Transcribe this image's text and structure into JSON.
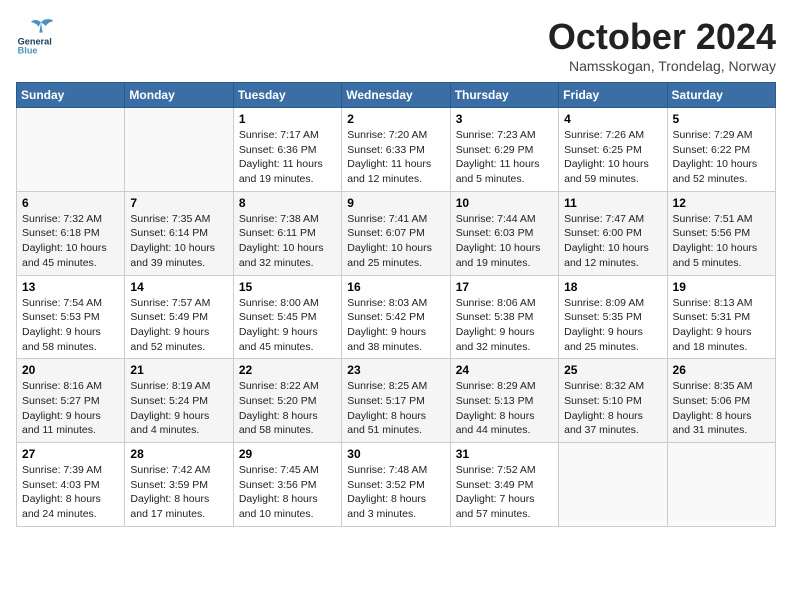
{
  "header": {
    "logo_general": "General",
    "logo_blue": "Blue",
    "month_title": "October 2024",
    "location": "Namsskogan, Trondelag, Norway"
  },
  "days_of_week": [
    "Sunday",
    "Monday",
    "Tuesday",
    "Wednesday",
    "Thursday",
    "Friday",
    "Saturday"
  ],
  "weeks": [
    [
      {
        "day": "",
        "info": ""
      },
      {
        "day": "",
        "info": ""
      },
      {
        "day": "1",
        "info": "Sunrise: 7:17 AM\nSunset: 6:36 PM\nDaylight: 11 hours\nand 19 minutes."
      },
      {
        "day": "2",
        "info": "Sunrise: 7:20 AM\nSunset: 6:33 PM\nDaylight: 11 hours\nand 12 minutes."
      },
      {
        "day": "3",
        "info": "Sunrise: 7:23 AM\nSunset: 6:29 PM\nDaylight: 11 hours\nand 5 minutes."
      },
      {
        "day": "4",
        "info": "Sunrise: 7:26 AM\nSunset: 6:25 PM\nDaylight: 10 hours\nand 59 minutes."
      },
      {
        "day": "5",
        "info": "Sunrise: 7:29 AM\nSunset: 6:22 PM\nDaylight: 10 hours\nand 52 minutes."
      }
    ],
    [
      {
        "day": "6",
        "info": "Sunrise: 7:32 AM\nSunset: 6:18 PM\nDaylight: 10 hours\nand 45 minutes."
      },
      {
        "day": "7",
        "info": "Sunrise: 7:35 AM\nSunset: 6:14 PM\nDaylight: 10 hours\nand 39 minutes."
      },
      {
        "day": "8",
        "info": "Sunrise: 7:38 AM\nSunset: 6:11 PM\nDaylight: 10 hours\nand 32 minutes."
      },
      {
        "day": "9",
        "info": "Sunrise: 7:41 AM\nSunset: 6:07 PM\nDaylight: 10 hours\nand 25 minutes."
      },
      {
        "day": "10",
        "info": "Sunrise: 7:44 AM\nSunset: 6:03 PM\nDaylight: 10 hours\nand 19 minutes."
      },
      {
        "day": "11",
        "info": "Sunrise: 7:47 AM\nSunset: 6:00 PM\nDaylight: 10 hours\nand 12 minutes."
      },
      {
        "day": "12",
        "info": "Sunrise: 7:51 AM\nSunset: 5:56 PM\nDaylight: 10 hours\nand 5 minutes."
      }
    ],
    [
      {
        "day": "13",
        "info": "Sunrise: 7:54 AM\nSunset: 5:53 PM\nDaylight: 9 hours\nand 58 minutes."
      },
      {
        "day": "14",
        "info": "Sunrise: 7:57 AM\nSunset: 5:49 PM\nDaylight: 9 hours\nand 52 minutes."
      },
      {
        "day": "15",
        "info": "Sunrise: 8:00 AM\nSunset: 5:45 PM\nDaylight: 9 hours\nand 45 minutes."
      },
      {
        "day": "16",
        "info": "Sunrise: 8:03 AM\nSunset: 5:42 PM\nDaylight: 9 hours\nand 38 minutes."
      },
      {
        "day": "17",
        "info": "Sunrise: 8:06 AM\nSunset: 5:38 PM\nDaylight: 9 hours\nand 32 minutes."
      },
      {
        "day": "18",
        "info": "Sunrise: 8:09 AM\nSunset: 5:35 PM\nDaylight: 9 hours\nand 25 minutes."
      },
      {
        "day": "19",
        "info": "Sunrise: 8:13 AM\nSunset: 5:31 PM\nDaylight: 9 hours\nand 18 minutes."
      }
    ],
    [
      {
        "day": "20",
        "info": "Sunrise: 8:16 AM\nSunset: 5:27 PM\nDaylight: 9 hours\nand 11 minutes."
      },
      {
        "day": "21",
        "info": "Sunrise: 8:19 AM\nSunset: 5:24 PM\nDaylight: 9 hours\nand 4 minutes."
      },
      {
        "day": "22",
        "info": "Sunrise: 8:22 AM\nSunset: 5:20 PM\nDaylight: 8 hours\nand 58 minutes."
      },
      {
        "day": "23",
        "info": "Sunrise: 8:25 AM\nSunset: 5:17 PM\nDaylight: 8 hours\nand 51 minutes."
      },
      {
        "day": "24",
        "info": "Sunrise: 8:29 AM\nSunset: 5:13 PM\nDaylight: 8 hours\nand 44 minutes."
      },
      {
        "day": "25",
        "info": "Sunrise: 8:32 AM\nSunset: 5:10 PM\nDaylight: 8 hours\nand 37 minutes."
      },
      {
        "day": "26",
        "info": "Sunrise: 8:35 AM\nSunset: 5:06 PM\nDaylight: 8 hours\nand 31 minutes."
      }
    ],
    [
      {
        "day": "27",
        "info": "Sunrise: 7:39 AM\nSunset: 4:03 PM\nDaylight: 8 hours\nand 24 minutes."
      },
      {
        "day": "28",
        "info": "Sunrise: 7:42 AM\nSunset: 3:59 PM\nDaylight: 8 hours\nand 17 minutes."
      },
      {
        "day": "29",
        "info": "Sunrise: 7:45 AM\nSunset: 3:56 PM\nDaylight: 8 hours\nand 10 minutes."
      },
      {
        "day": "30",
        "info": "Sunrise: 7:48 AM\nSunset: 3:52 PM\nDaylight: 8 hours\nand 3 minutes."
      },
      {
        "day": "31",
        "info": "Sunrise: 7:52 AM\nSunset: 3:49 PM\nDaylight: 7 hours\nand 57 minutes."
      },
      {
        "day": "",
        "info": ""
      },
      {
        "day": "",
        "info": ""
      }
    ]
  ]
}
